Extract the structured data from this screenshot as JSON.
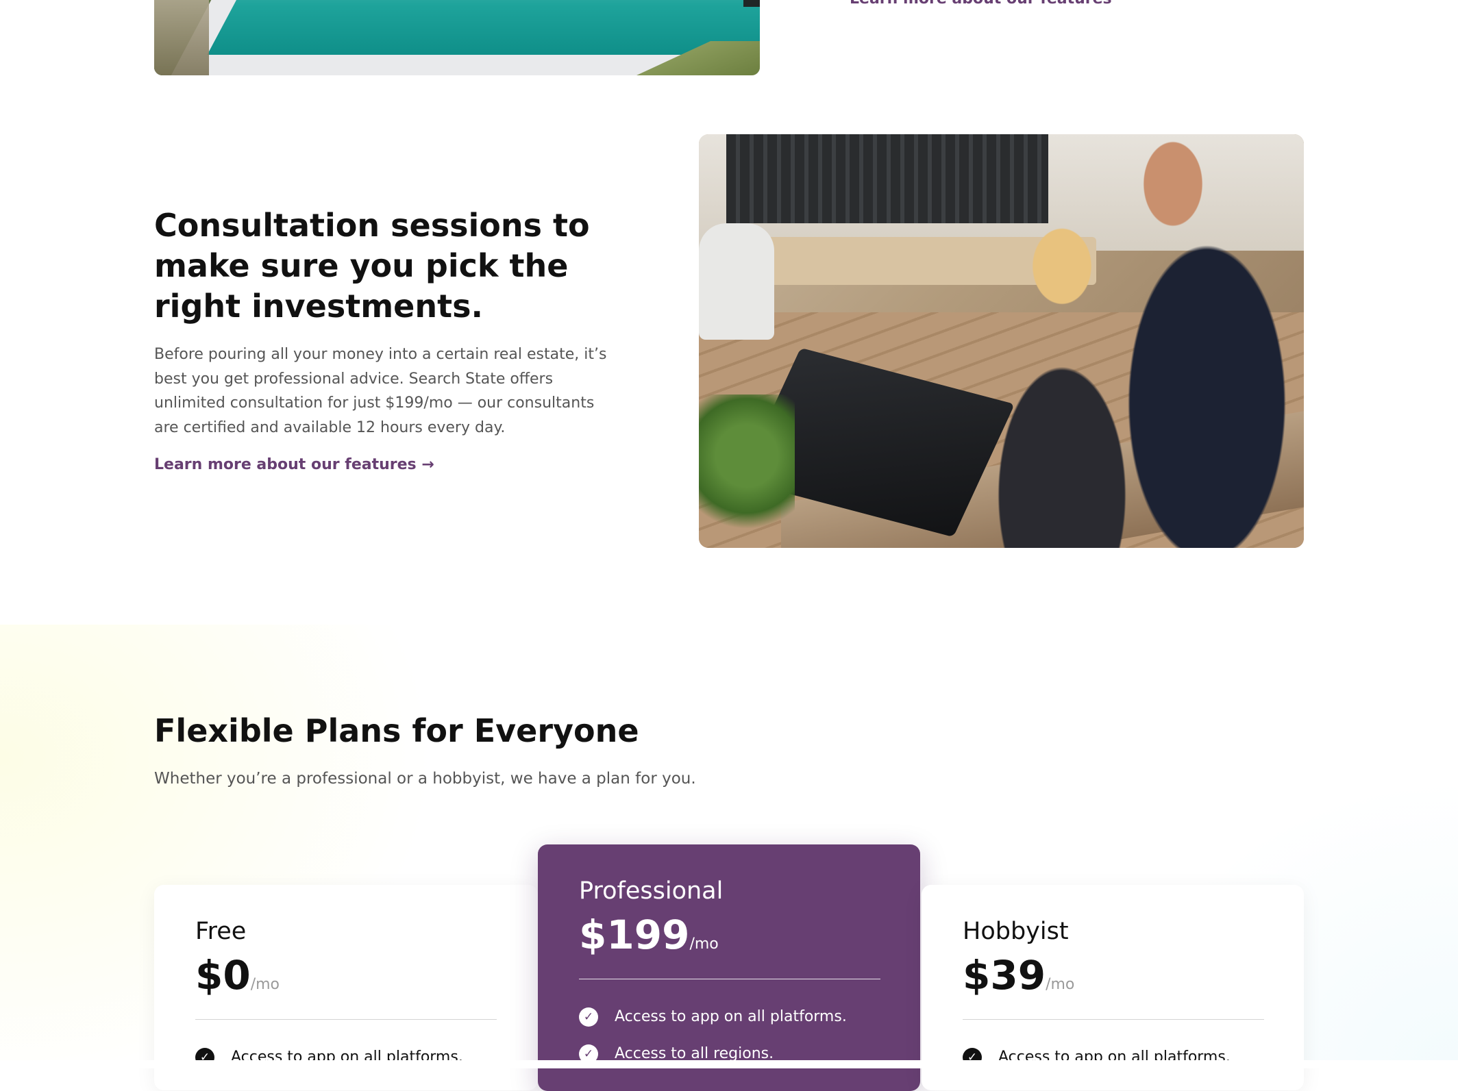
{
  "top_section": {
    "link_label": "Learn more about our features"
  },
  "consultation": {
    "title": "Consultation sessions to make sure you pick the right investments.",
    "body": "Before pouring all your money into a certain real estate, it’s best you get professional advice. Search State offers unlimited consultation for just $199/mo — our consultants are certified and available 12 hours every day.",
    "link_label": "Learn more about our features →"
  },
  "pricing": {
    "title": "Flexible Plans for Everyone",
    "subtitle": "Whether you’re a professional or a hobbyist, we have a plan for you.",
    "plans": [
      {
        "name": "Free",
        "price": "$0",
        "period": "/mo",
        "features": [
          "Access to app on all platforms."
        ]
      },
      {
        "name": "Professional",
        "price": "$199",
        "period": "/mo",
        "features": [
          "Access to app on all platforms.",
          "Access to all regions."
        ]
      },
      {
        "name": "Hobbyist",
        "price": "$39",
        "period": "/mo",
        "features": [
          "Access to app on all platforms."
        ]
      }
    ]
  },
  "colors": {
    "accent": "#673f72",
    "heading": "#111111",
    "body_text": "#555555"
  },
  "icons": {
    "feature_check": "check-circle-icon"
  }
}
